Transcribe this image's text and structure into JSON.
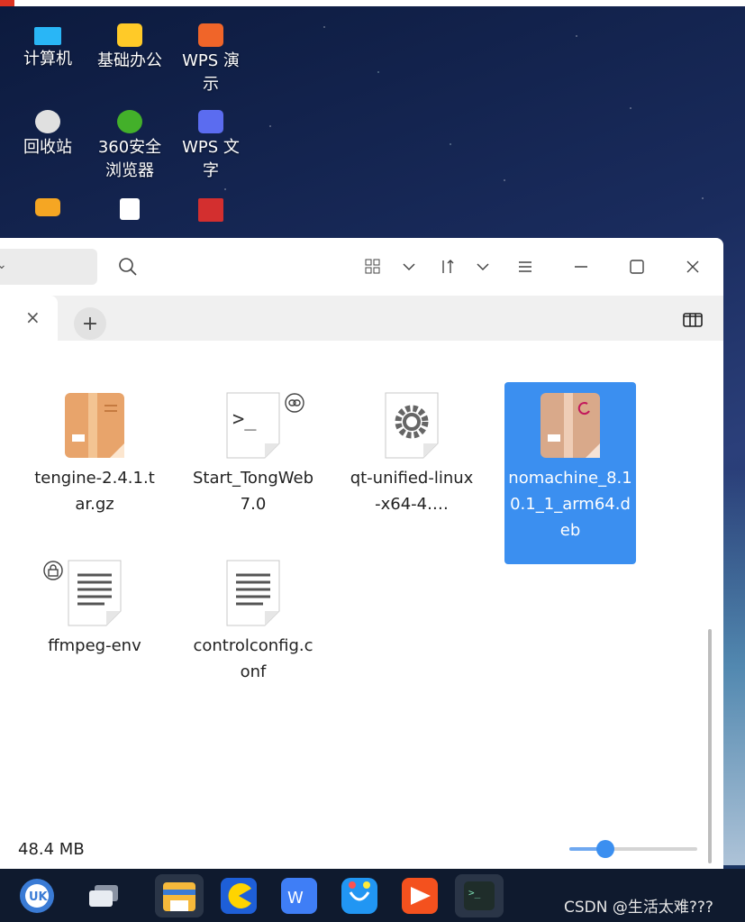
{
  "desktop": {
    "icons": [
      {
        "label": "计算机",
        "icon": "computer-icon",
        "color": "#29b6f6"
      },
      {
        "label": "基础办公",
        "icon": "office-folder-icon",
        "color": "#ffca28"
      },
      {
        "label": "WPS 演示",
        "icon": "wps-presentation-icon",
        "color": "#f06529"
      },
      {
        "label": "回收站",
        "icon": "trash-icon",
        "color": "#e0e0e0"
      },
      {
        "label": "360安全浏览器",
        "icon": "browser-360-icon",
        "color": "#43b02a"
      },
      {
        "label": "WPS 文字",
        "icon": "wps-writer-icon",
        "color": "#5b6cf0"
      },
      {
        "label": "",
        "icon": "home-folder-icon",
        "color": "#f5a623"
      },
      {
        "label": "",
        "icon": "text-file-icon",
        "color": "#ffffff"
      },
      {
        "label": "",
        "icon": "red-app-icon",
        "color": "#d32f2f"
      }
    ]
  },
  "window": {
    "toolbar": {
      "search_icon": "search-icon",
      "view_icon": "grid-view-icon",
      "sort_icon": "sort-icon",
      "menu_icon": "menu-icon"
    },
    "tabs": {
      "close": "×",
      "add": "+"
    },
    "files": [
      {
        "name": "tengine-2.4.1.tar.gz",
        "icon": "archive-icon",
        "selected": false,
        "badge": ""
      },
      {
        "name": "Start_TongWeb7.0",
        "icon": "terminal-script-icon",
        "selected": false,
        "badge": "link-icon"
      },
      {
        "name": "qt-unified-linux-x64-4.…",
        "icon": "executable-gear-icon",
        "selected": false,
        "badge": ""
      },
      {
        "name": "nomachine_8.10.1_1_arm64.deb",
        "icon": "deb-package-icon",
        "selected": true,
        "badge": ""
      },
      {
        "name": "ffmpeg-env",
        "icon": "text-document-icon",
        "selected": false,
        "badge": "lock-icon"
      },
      {
        "name": "controlconfig.conf",
        "icon": "text-document-icon",
        "selected": false,
        "badge": ""
      }
    ],
    "status": {
      "size": "48.4 MB"
    },
    "zoom_slider": {
      "value": 0.2
    }
  },
  "taskbar": {
    "apps": [
      "start-menu-icon",
      "multitask-view-icon",
      "file-manager-icon",
      "pacman-app-icon",
      "wps-icon",
      "app-store-icon",
      "video-player-icon",
      "terminal-icon"
    ],
    "accent": "#3b8ff0"
  },
  "watermark": "CSDN @生活太难???"
}
